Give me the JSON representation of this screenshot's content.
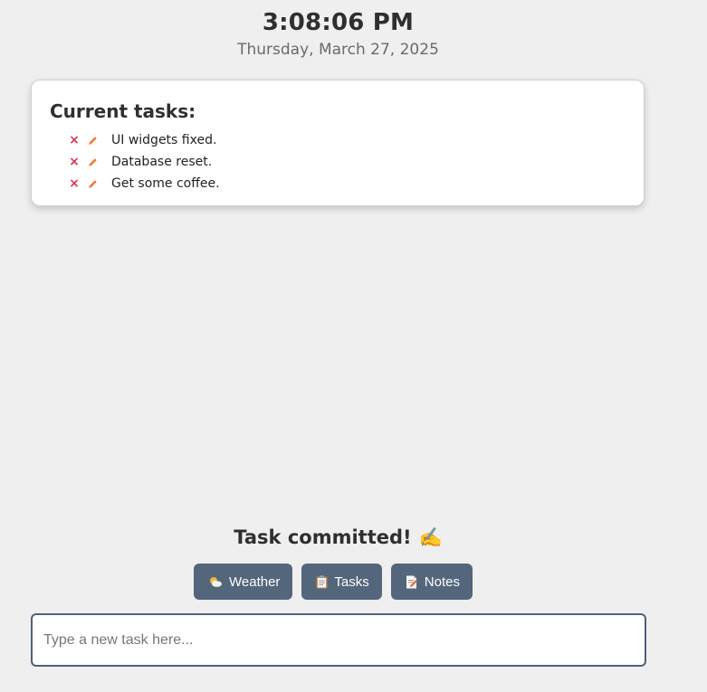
{
  "clock": {
    "time": "3:08:06 PM",
    "date": "Thursday, March 27, 2025"
  },
  "tasks": {
    "title": "Current tasks:",
    "delete_icon": "×",
    "items": [
      {
        "text": "UI widgets fixed."
      },
      {
        "text": "Database reset."
      },
      {
        "text": "Get some coffee."
      }
    ]
  },
  "status": {
    "message": "Task committed!",
    "emoji": "✍️"
  },
  "nav": {
    "weather_label": "Weather",
    "tasks_label": "Tasks",
    "notes_label": "Notes"
  },
  "input": {
    "placeholder": "Type a new task here...",
    "value": ""
  },
  "colors": {
    "background": "#efefef",
    "button": "#53667c",
    "delete": "#e0324f",
    "edit": "#f07a2a",
    "input_border": "#4f6179"
  },
  "icons": {
    "delete": "close-icon",
    "edit": "pencil-icon",
    "weather": "sun-cloud-icon",
    "tasks": "clipboard-icon",
    "notes": "memo-icon"
  }
}
